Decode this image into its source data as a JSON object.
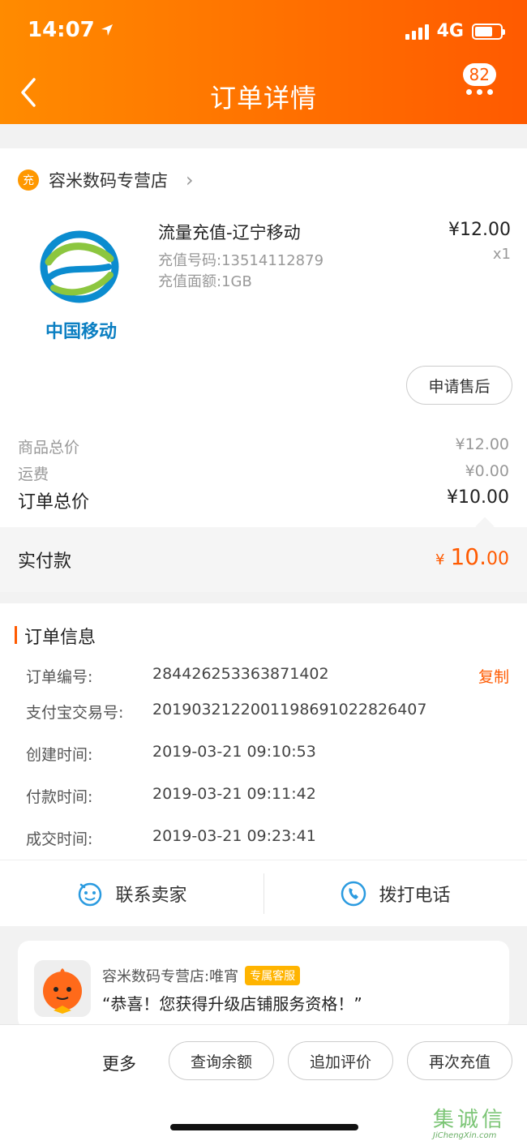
{
  "status": {
    "time": "14:07",
    "network": "4G"
  },
  "nav": {
    "title": "订单详情",
    "badge": "82"
  },
  "shop": {
    "icon_char": "充",
    "name": "容米数码专营店"
  },
  "product": {
    "title": "流量充值-辽宁移动",
    "phone_label": "充值号码:13514112879",
    "amount_label": "充值面额:1GB",
    "price": "¥12.00",
    "qty": "x1",
    "brand_text": "中国移动",
    "after_sale": "申请售后"
  },
  "summary": {
    "goods_label": "商品总价",
    "goods_value": "¥12.00",
    "shipping_label": "运费",
    "shipping_value": "¥0.00",
    "total_label": "订单总价",
    "total_value": "¥10.00"
  },
  "paid": {
    "label": "实付款",
    "currency": "¥",
    "int": "10.",
    "dec": "00"
  },
  "order_info": {
    "title": "订单信息",
    "copy": "复制",
    "rows": [
      {
        "k": "订单编号:",
        "v": "284426253363871402"
      },
      {
        "k": "支付宝交易号:",
        "v": "2019032122001198691022826407"
      },
      {
        "k": "创建时间:",
        "v": "2019-03-21 09:10:53"
      },
      {
        "k": "付款时间:",
        "v": "2019-03-21 09:11:42"
      },
      {
        "k": "成交时间:",
        "v": "2019-03-21 09:23:41"
      }
    ]
  },
  "contact": {
    "seller": "联系卖家",
    "phone": "拨打电话"
  },
  "message": {
    "name": "容米数码专营店:唯宵",
    "tag": "专属客服",
    "text": "“恭喜！您获得升级店铺服务资格！”"
  },
  "bottom": {
    "more": "更多",
    "buttons": [
      "查询余额",
      "追加评价",
      "再次充值"
    ]
  },
  "watermark": {
    "cn": "集诚信",
    "en": "JiChengXin.com"
  },
  "colors": {
    "accent": "#ff5a00",
    "header_start": "#ff8b00"
  }
}
